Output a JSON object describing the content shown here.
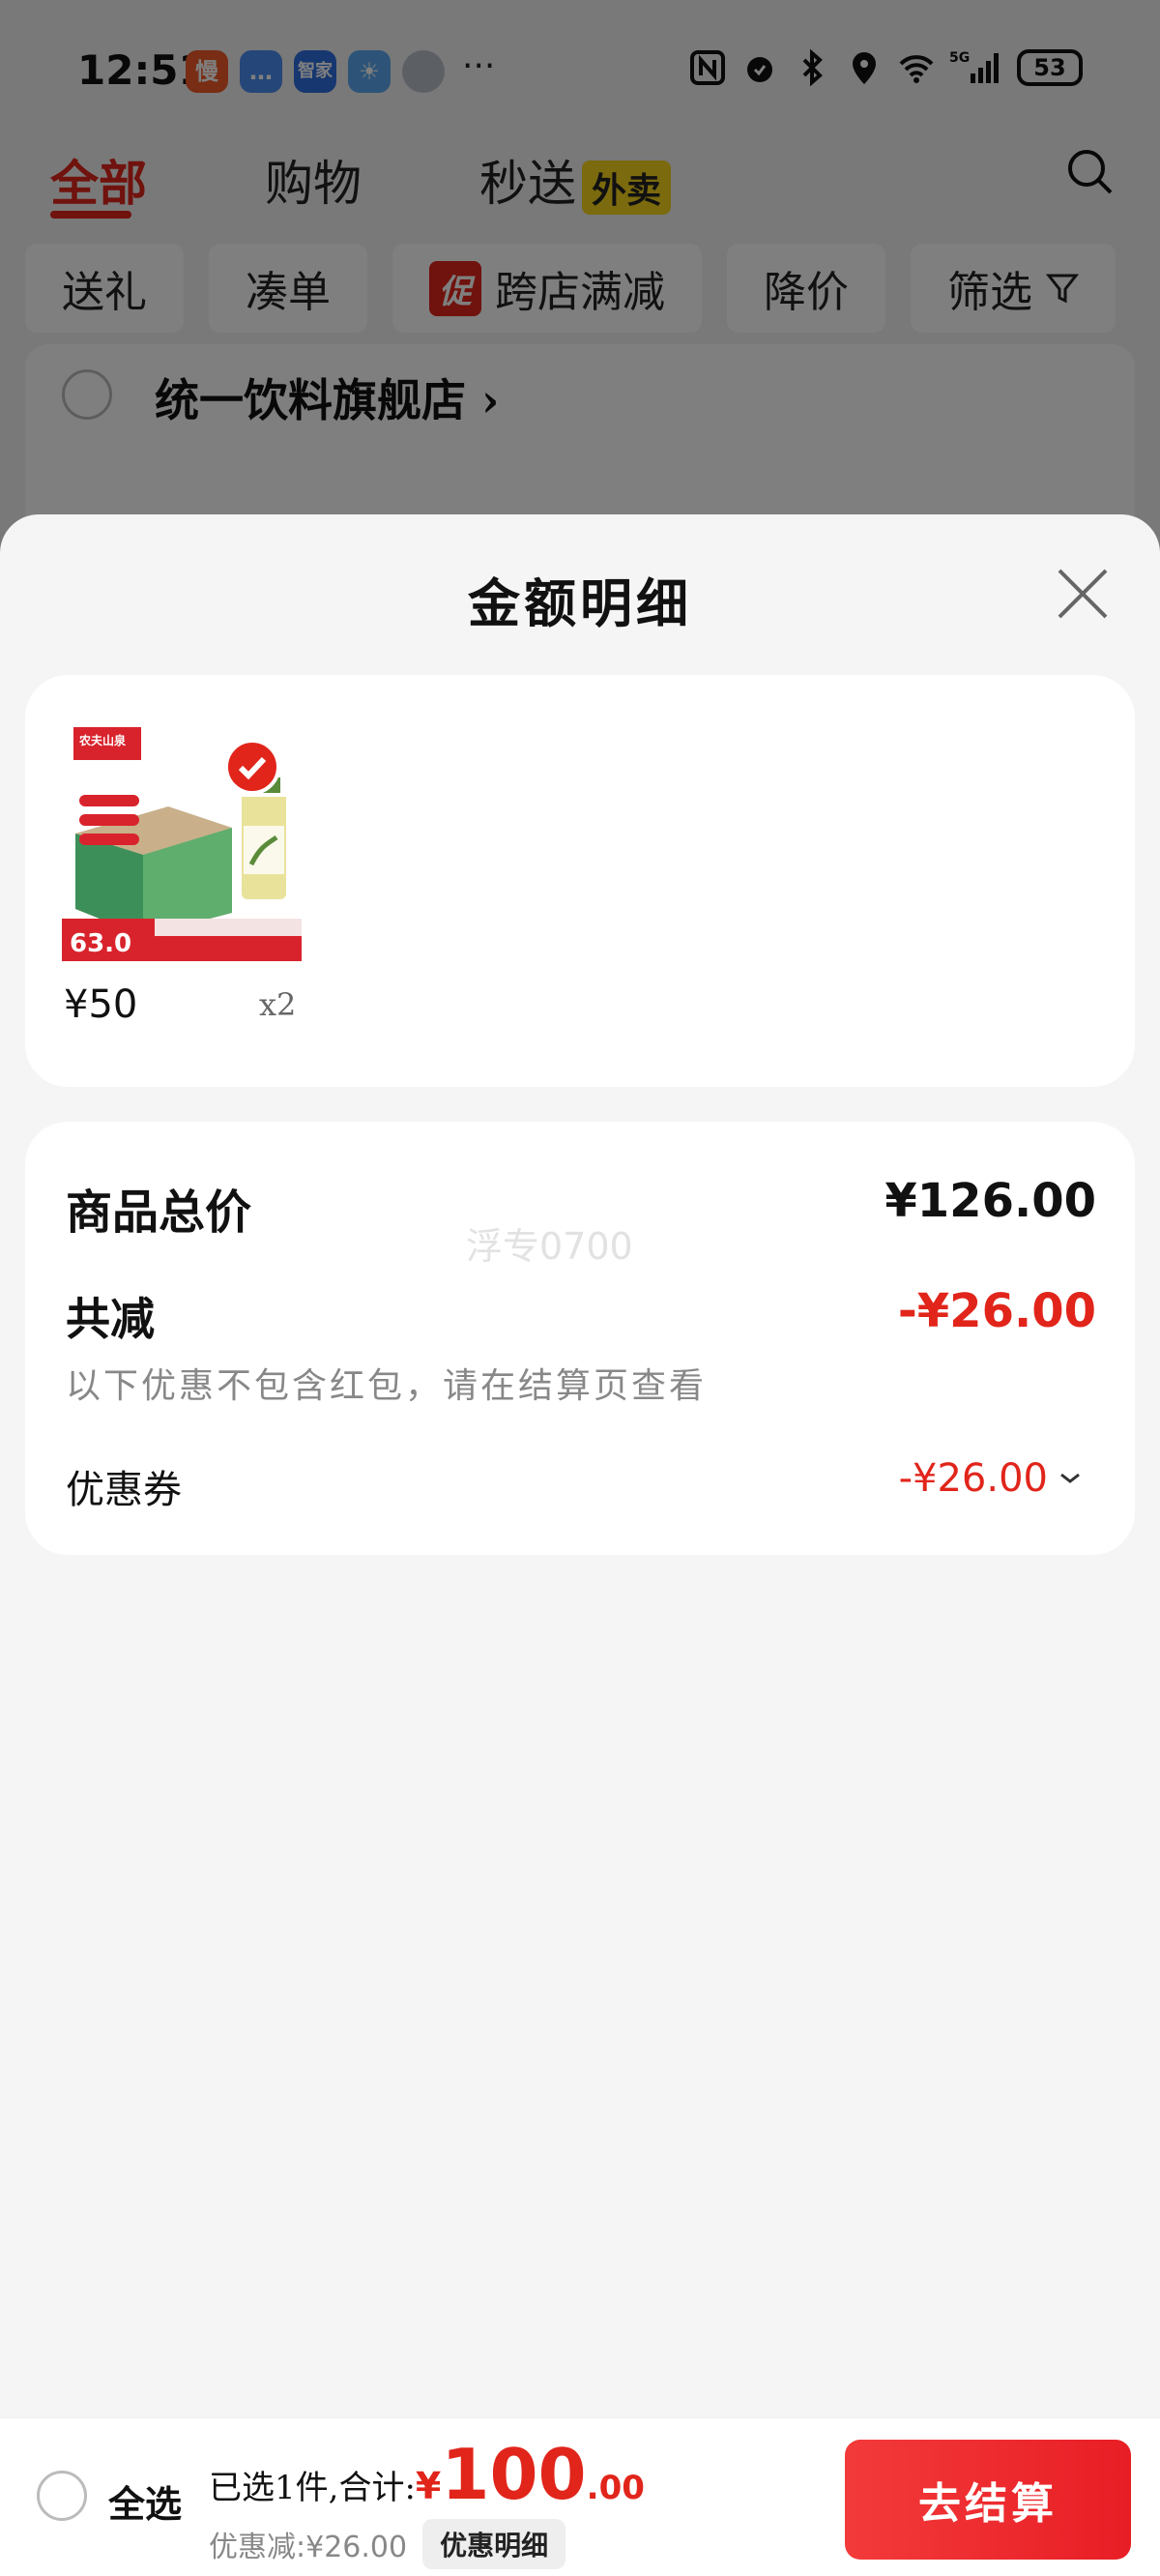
{
  "status_bar": {
    "time": "12:51",
    "app_icons": [
      {
        "label": "慢",
        "color": "#f05a28"
      },
      {
        "label": "…",
        "color": "#4a8df0"
      },
      {
        "label": "智家",
        "color": "#2f6fe0"
      },
      {
        "label": "☀",
        "color": "#5aa9f0"
      },
      {
        "label": "",
        "color": "#b9c0c8"
      }
    ],
    "more": "···",
    "battery": "53"
  },
  "tabs": [
    {
      "label": "全部",
      "active": true
    },
    {
      "label": "购物",
      "active": false
    },
    {
      "label": "秒送",
      "active": false,
      "badge": "外卖"
    }
  ],
  "filters": {
    "gift": "送礼",
    "bundle": "凑单",
    "promo_icon": "促",
    "cross_store": "跨店满减",
    "price_drop": "降价",
    "filter": "筛选"
  },
  "store": {
    "name": "统一饮料旗舰店",
    "arrow": "›"
  },
  "sheet": {
    "title": "金额明细",
    "product": {
      "brand": "农夫山泉",
      "price_tag": "63.0",
      "price": "¥50",
      "qty": "x2"
    },
    "summary": {
      "total_label": "商品总价",
      "total_value": "¥126.00",
      "watermark": "浮专0700",
      "discount_label": "共减",
      "discount_value": "-¥26.00",
      "note": "以下优惠不包含红包，请在结算页查看",
      "coupon_label": "优惠券",
      "coupon_value": "-¥26.00"
    }
  },
  "checkout": {
    "select_all": "全选",
    "selected_text": "已选1件,合计:",
    "total_symbol": "¥",
    "total_int": "100",
    "total_dec": ".00",
    "discount_text": "优惠减:¥26.00",
    "detail_button": "优惠明细",
    "checkout_button": "去结算"
  },
  "colors": {
    "accent": "#e1251b",
    "badge_yellow": "#f7d51d"
  }
}
